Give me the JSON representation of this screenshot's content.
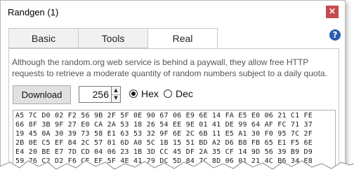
{
  "window": {
    "title": "Randgen (1)",
    "close_glyph": "×"
  },
  "tabs": [
    {
      "label": "Basic",
      "active": false
    },
    {
      "label": "Tools",
      "active": false
    },
    {
      "label": "Real",
      "active": true
    }
  ],
  "help": {
    "glyph": "?"
  },
  "description": "Although the random.org web service is behind a paywall, they allow free HTTP requests to retrieve a moderate quantity of random numbers subject to a daily quota.",
  "controls": {
    "download_label": "Download",
    "count_value": "256",
    "spin_up": "▲",
    "spin_down": "▼",
    "format_hex_label": "Hex",
    "format_dec_label": "Dec",
    "selected_format": "Hex"
  },
  "output": {
    "lines": [
      "A5 7C D0 02 F2 56 9B 2F 5F 0E 90 67 06 E9 6E 14 FA E5 E0 06 21 C1 FE",
      "66 8F 3B 9F 27 E0 CA 2A 53 18 26 54 EE 9E 01 41 DE 99 64 AF FC 71 37",
      "19 45 0A 30 39 73 58 E1 63 53 32 9F 6E 2C 6B 11 E5 A1 30 F0 95 7C 2F",
      "2B 0E C5 EF 84 2C 57 01 6D A0 5C 1B 15 51 BD A2 D6 B8 FB 65 E1 F5 6E",
      "E4 20 BE E7 7D CD 04 06 23 1B 3D CC 45 DF 2A 35 CF 14 9D 56 39 B9 D9",
      "59 76 C2 D2 F6 CE EF 5F 4E 41 79 DC 5D 84 7C 8D 06 01 21 4C B6 34 E8"
    ]
  }
}
